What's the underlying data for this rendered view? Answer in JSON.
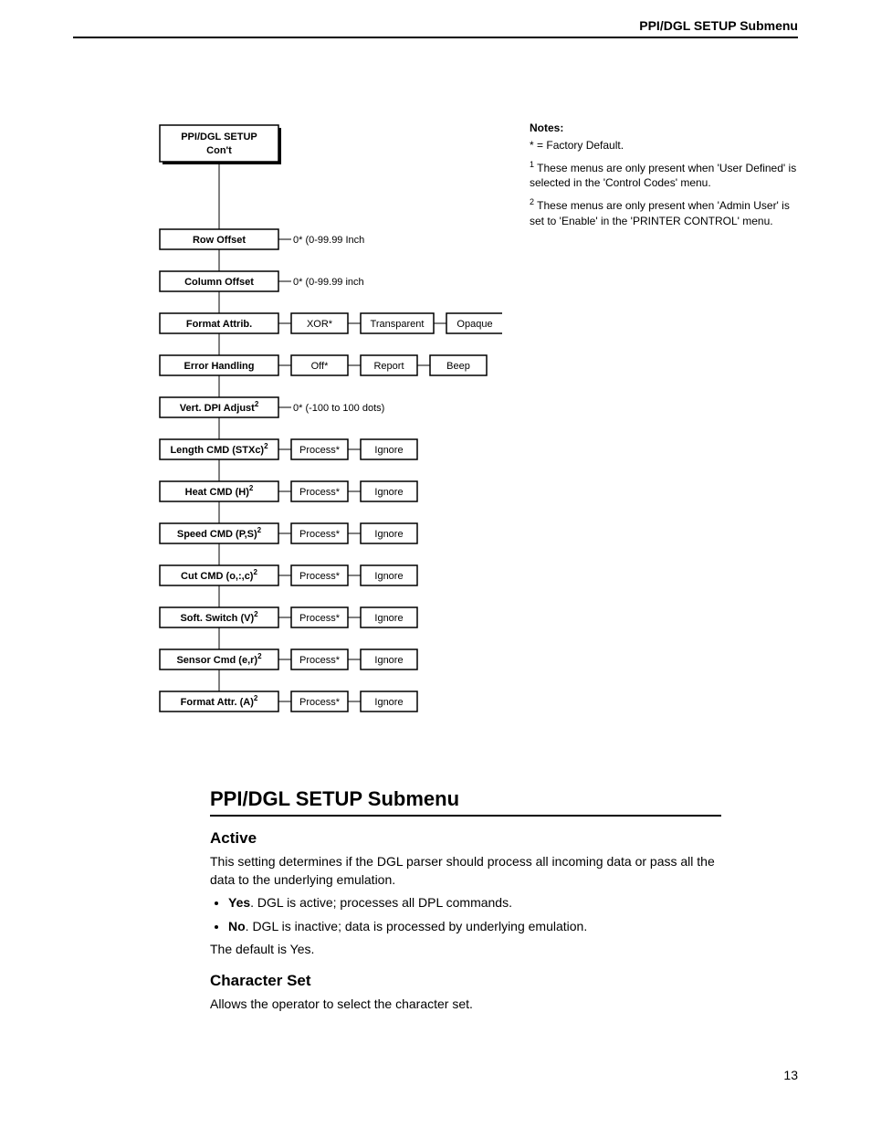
{
  "header": {
    "running_title": "PPI/DGL SETUP Submenu"
  },
  "page_number": "13",
  "tree": {
    "root": {
      "line1": "PPI/DGL SETUP",
      "line2": "Con't"
    },
    "rows": [
      {
        "label": "Row Offset",
        "sup": "",
        "opts": [
          {
            "text": "0* (0-99.99 Inch",
            "boxed": false
          }
        ]
      },
      {
        "label": "Column Offset",
        "sup": "",
        "opts": [
          {
            "text": "0* (0-99.99 inch",
            "boxed": false
          }
        ]
      },
      {
        "label": "Format Attrib.",
        "sup": "",
        "opts": [
          {
            "text": "XOR*",
            "boxed": true
          },
          {
            "text": "Transparent",
            "boxed": true
          },
          {
            "text": "Opaque",
            "boxed": true
          }
        ]
      },
      {
        "label": "Error Handling",
        "sup": "",
        "opts": [
          {
            "text": "Off*",
            "boxed": true
          },
          {
            "text": "Report",
            "boxed": true
          },
          {
            "text": "Beep",
            "boxed": true
          }
        ]
      },
      {
        "label": "Vert. DPI Adjust",
        "sup": "2",
        "opts": [
          {
            "text": "0* (-100 to 100 dots)",
            "boxed": false
          }
        ]
      },
      {
        "label": "Length CMD (STXc)",
        "sup": "2",
        "opts": [
          {
            "text": "Process*",
            "boxed": true
          },
          {
            "text": "Ignore",
            "boxed": true
          }
        ]
      },
      {
        "label": "Heat CMD (H)",
        "sup": "2",
        "opts": [
          {
            "text": "Process*",
            "boxed": true
          },
          {
            "text": "Ignore",
            "boxed": true
          }
        ]
      },
      {
        "label": "Speed CMD (P,S)",
        "sup": "2",
        "opts": [
          {
            "text": "Process*",
            "boxed": true
          },
          {
            "text": "Ignore",
            "boxed": true
          }
        ]
      },
      {
        "label": "Cut CMD (o,:,c)",
        "sup": "2",
        "opts": [
          {
            "text": "Process*",
            "boxed": true
          },
          {
            "text": "Ignore",
            "boxed": true
          }
        ]
      },
      {
        "label": "Soft. Switch (V)",
        "sup": "2",
        "opts": [
          {
            "text": "Process*",
            "boxed": true
          },
          {
            "text": "Ignore",
            "boxed": true
          }
        ]
      },
      {
        "label": "Sensor Cmd (e,r)",
        "sup": "2",
        "opts": [
          {
            "text": "Process*",
            "boxed": true
          },
          {
            "text": "Ignore",
            "boxed": true
          }
        ]
      },
      {
        "label": "Format Attr. (A)",
        "sup": "2",
        "opts": [
          {
            "text": "Process*",
            "boxed": true
          },
          {
            "text": "Ignore",
            "boxed": true
          }
        ]
      }
    ]
  },
  "notes": {
    "title": "Notes:",
    "items": [
      {
        "marker": "*",
        "text": "= Factory Default."
      },
      {
        "marker": "1",
        "text": "These menus are only present when 'User Defined' is selected in the 'Control Codes' menu."
      },
      {
        "marker": "2",
        "text": "These menus are only present when 'Admin User' is set to 'Enable' in the 'PRINTER CONTROL' menu."
      }
    ]
  },
  "section": {
    "title": "PPI/DGL SETUP Submenu",
    "active": {
      "heading": "Active",
      "para1": "This setting determines if the DGL parser should process all incoming data or pass all the data to the underlying emulation.",
      "yes_bold": "Yes",
      "yes_rest": ". DGL is active; processes all DPL commands.",
      "no_bold": "No",
      "no_rest": ". DGL is inactive; data is processed by underlying emulation.",
      "default": "The default is Yes."
    },
    "charset": {
      "heading": "Character Set",
      "para": "Allows the operator to select the character set."
    }
  }
}
